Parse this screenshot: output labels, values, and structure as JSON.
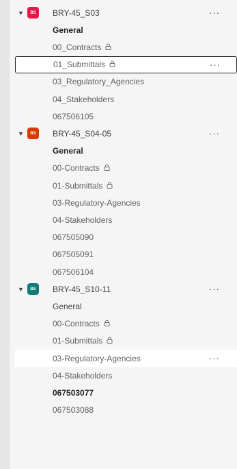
{
  "teams": [
    {
      "name": "BRY-45_S03",
      "avatar": "BS",
      "avatar_color": "#e8154b",
      "more": "···",
      "channels": [
        {
          "label": "General",
          "bold": true
        },
        {
          "label": "00_Contracts",
          "locked": true
        },
        {
          "label": "01_Submittals",
          "locked": true,
          "selected": true,
          "more": "···"
        },
        {
          "label": "03_Regulatory_Agencies"
        },
        {
          "label": "04_Stakeholders"
        },
        {
          "label": "067506105"
        }
      ]
    },
    {
      "name": "BRY-45_S04-05",
      "avatar": "BS",
      "avatar_color": "#d83b01",
      "more": "···",
      "channels": [
        {
          "label": "General",
          "bold": true
        },
        {
          "label": "00-Contracts",
          "locked": true
        },
        {
          "label": "01-Submittals",
          "locked": true
        },
        {
          "label": "03-Regulatory-Agencies"
        },
        {
          "label": "04-Stakeholders"
        },
        {
          "label": "067505090"
        },
        {
          "label": "067505091"
        },
        {
          "label": "067506104"
        }
      ]
    },
    {
      "name": "BRY-45_S10-11",
      "avatar": "BS",
      "avatar_color": "#0f7b7b",
      "more": "···",
      "channels": [
        {
          "label": "General",
          "regular": true
        },
        {
          "label": "00-Contracts",
          "locked": true
        },
        {
          "label": "01-Submittals",
          "locked": true
        },
        {
          "label": "03-Regulatory-Agencies",
          "hover": true,
          "more": "···"
        },
        {
          "label": "04-Stakeholders"
        },
        {
          "label": "067503077",
          "bold": true
        },
        {
          "label": "067503088"
        }
      ]
    }
  ],
  "icons": {
    "chevron": "chevron-down-icon",
    "lock": "lock-icon"
  }
}
